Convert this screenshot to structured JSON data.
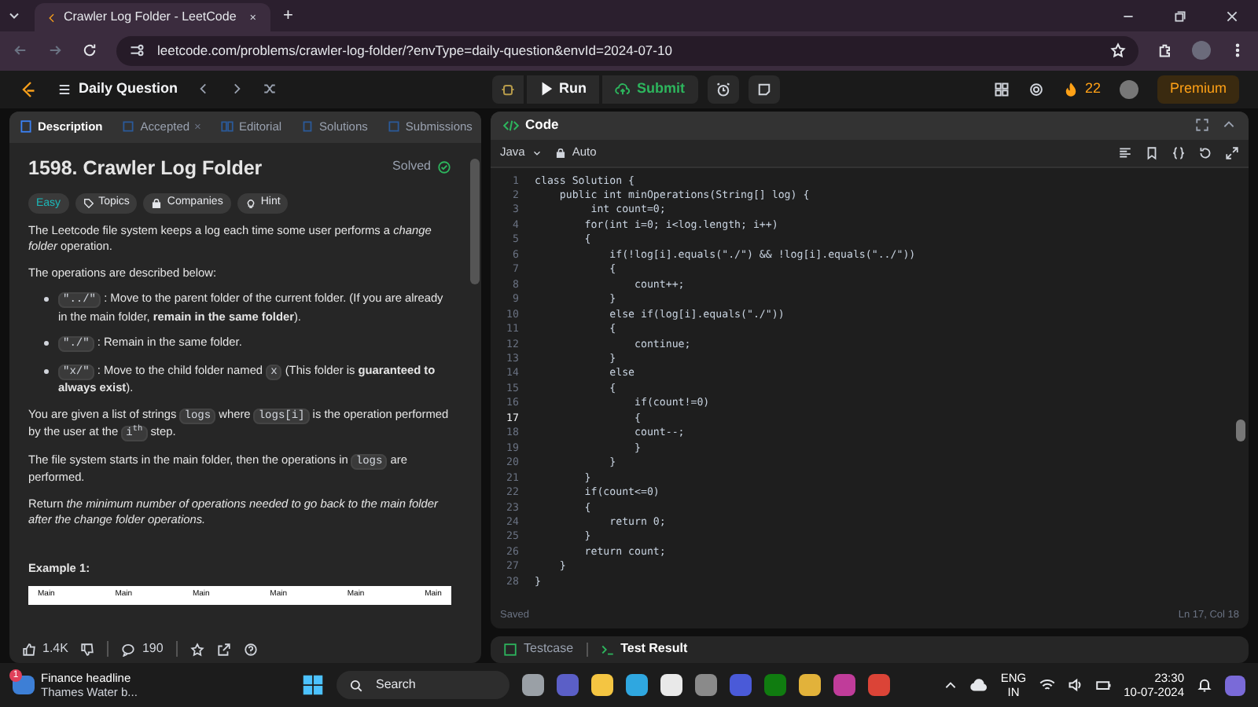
{
  "browser": {
    "tab_title": "Crawler Log Folder - LeetCode",
    "new_tab": "+",
    "url": "leetcode.com/problems/crawler-log-folder/?envType=daily-question&envId=2024-07-10"
  },
  "navbar": {
    "title": "Daily Question",
    "run": "Run",
    "submit": "Submit",
    "streak": "22",
    "premium": "Premium"
  },
  "left_tabs": [
    {
      "label": "Description",
      "selected": true,
      "closable": false
    },
    {
      "label": "Accepted",
      "selected": false,
      "closable": true
    },
    {
      "label": "Editorial",
      "selected": false,
      "closable": false
    },
    {
      "label": "Solutions",
      "selected": false,
      "closable": false
    },
    {
      "label": "Submissions",
      "selected": false,
      "closable": false
    }
  ],
  "close_mark": "×",
  "problem": {
    "title": "1598. Crawler Log Folder",
    "status": "Solved",
    "tags": [
      {
        "label": "Easy",
        "kind": "difficulty"
      },
      {
        "label": "Topics",
        "kind": "topics"
      },
      {
        "label": "Companies",
        "kind": "companies"
      },
      {
        "label": "Hint",
        "kind": "hint"
      }
    ],
    "intro": "The Leetcode file system keeps a log each time some user performs a *change folder* operation.",
    "ops_intro": "The operations are described below:",
    "bullets": [
      [
        {
          "kind": "code",
          "text": "\"../\""
        },
        {
          "kind": "text",
          "text": " : Move to the parent folder of the current folder. (If you are already in the main folder, **remain in the same folder**)."
        }
      ],
      [
        {
          "kind": "code",
          "text": "\"./\""
        },
        {
          "kind": "text",
          "text": " : Remain in the same folder."
        }
      ],
      [
        {
          "kind": "code",
          "text": "\"x/\""
        },
        {
          "kind": "text",
          "text": " : Move to the child folder named "
        },
        {
          "kind": "code",
          "text": "x"
        },
        {
          "kind": "text",
          "text": " (This folder is **guaranteed to always exist**)."
        }
      ]
    ],
    "p_given": [
      {
        "kind": "text",
        "text": "You are given a list of strings "
      },
      {
        "kind": "code",
        "text": "logs"
      },
      {
        "kind": "text",
        "text": " where "
      },
      {
        "kind": "code",
        "text": "logs[i]"
      },
      {
        "kind": "text",
        "text": " is the operation performed by the user at the "
      },
      {
        "kind": "code",
        "text": "i$^{th}$"
      },
      {
        "kind": "text",
        "text": " step."
      }
    ],
    "p_start": [
      {
        "kind": "text",
        "text": "The file system starts in the main folder, then the operations in "
      },
      {
        "kind": "code",
        "text": "logs"
      },
      {
        "kind": "text",
        "text": " are performed."
      }
    ],
    "p_return": "Return *the minimum number of operations needed to go back to the main folder after the change folder operations.*",
    "example_title": "Example 1:",
    "example_labels": [
      "Main",
      "Main",
      "Main",
      "Main",
      "Main",
      "Main"
    ]
  },
  "footer": {
    "likes": "1.4K",
    "comments": "190"
  },
  "code_panel": {
    "title": "Code",
    "language": "Java",
    "mode": "Auto",
    "saved": "Saved",
    "cursor": "Ln 17, Col 18"
  },
  "code_lines": [
    {
      "number": "1",
      "text": "class Solution {",
      "current": false
    },
    {
      "number": "2",
      "text": "    public int minOperations(String[] log) {",
      "current": false
    },
    {
      "number": "3",
      "text": "         int count=0;",
      "current": false
    },
    {
      "number": "4",
      "text": "        for(int i=0; i<log.length; i++)",
      "current": false
    },
    {
      "number": "5",
      "text": "        {",
      "current": false
    },
    {
      "number": "6",
      "text": "            if(!log[i].equals(\"./\") && !log[i].equals(\"../\"))",
      "current": false
    },
    {
      "number": "7",
      "text": "            {",
      "current": false
    },
    {
      "number": "8",
      "text": "                count++;",
      "current": false
    },
    {
      "number": "9",
      "text": "            }",
      "current": false
    },
    {
      "number": "10",
      "text": "            else if(log[i].equals(\"./\"))",
      "current": false
    },
    {
      "number": "11",
      "text": "            {",
      "current": false
    },
    {
      "number": "12",
      "text": "                continue;",
      "current": false
    },
    {
      "number": "13",
      "text": "            }",
      "current": false
    },
    {
      "number": "14",
      "text": "            else",
      "current": false
    },
    {
      "number": "15",
      "text": "            {",
      "current": false
    },
    {
      "number": "16",
      "text": "                if(count!=0)",
      "current": false
    },
    {
      "number": "17",
      "text": "                {",
      "current": true
    },
    {
      "number": "18",
      "text": "                count--;",
      "current": false
    },
    {
      "number": "19",
      "text": "                }",
      "current": false
    },
    {
      "number": "20",
      "text": "            }",
      "current": false
    },
    {
      "number": "21",
      "text": "        }",
      "current": false
    },
    {
      "number": "22",
      "text": "        if(count<=0)",
      "current": false
    },
    {
      "number": "23",
      "text": "        {",
      "current": false
    },
    {
      "number": "24",
      "text": "            return 0;",
      "current": false
    },
    {
      "number": "25",
      "text": "        }",
      "current": false
    },
    {
      "number": "26",
      "text": "        return count;",
      "current": false
    },
    {
      "number": "27",
      "text": "    }",
      "current": false
    },
    {
      "number": "28",
      "text": "}",
      "current": false
    }
  ],
  "bottom_tabs": [
    {
      "label": "Testcase",
      "selected": false
    },
    {
      "label": "Test Result",
      "selected": true
    }
  ],
  "taskbar": {
    "news_badge": "1",
    "news_title": "Finance headline",
    "news_text": "Thames Water b...",
    "search": "Search",
    "lang": "ENG",
    "region": "IN",
    "time": "23:30",
    "date": "10-07-2024"
  }
}
